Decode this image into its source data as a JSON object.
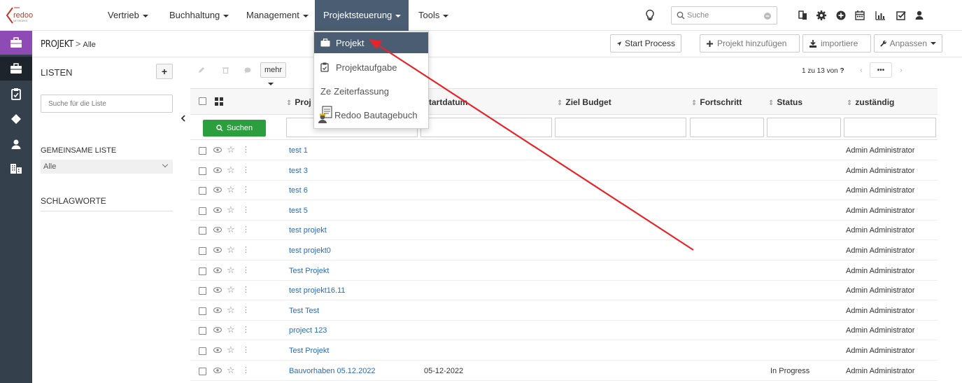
{
  "logo": {
    "text": "redoo",
    "subtext": "NETWORKS",
    "color": "#c0392b"
  },
  "nav": {
    "items": [
      {
        "label": "Vertrieb"
      },
      {
        "label": "Buchhaltung"
      },
      {
        "label": "Management"
      },
      {
        "label": "Projektsteuerung"
      },
      {
        "label": "Tools"
      }
    ],
    "search_placeholder": "Suche"
  },
  "breadcrumb": {
    "module": "PROJEKT",
    "separator": ">",
    "view": "Alle"
  },
  "actions": {
    "start_process": "Start Process",
    "add_project": "Projekt hinzufügen",
    "import": "importiere",
    "customize": "Anpassen"
  },
  "lists_panel": {
    "title": "LISTEN",
    "add": "+",
    "search_placeholder": "Suche für die Liste",
    "shared_title": "GEMEINSAME LISTE",
    "shared_selected": "Alle",
    "tags_title": "SCHLAGWORTE"
  },
  "toolbar": {
    "more": "mehr"
  },
  "paging": {
    "text": "1 zu 13 von",
    "unknown": "?",
    "more": "•••"
  },
  "table": {
    "columns": {
      "name": "Proj",
      "start": "Startdatum",
      "budget": "Ziel Budget",
      "progress": "Fortschritt",
      "status": "Status",
      "owner": "zuständig"
    },
    "search_button": "Suchen",
    "rows": [
      {
        "name": "test 1",
        "date": "",
        "status": "",
        "owner": "Admin Administrator"
      },
      {
        "name": "test 3",
        "date": "",
        "status": "",
        "owner": "Admin Administrator"
      },
      {
        "name": "test 6",
        "date": "",
        "status": "",
        "owner": "Admin Administrator"
      },
      {
        "name": "test 5",
        "date": "",
        "status": "",
        "owner": "Admin Administrator"
      },
      {
        "name": "test projekt",
        "date": "",
        "status": "",
        "owner": "Admin Administrator"
      },
      {
        "name": "test projekt0",
        "date": "",
        "status": "",
        "owner": "Admin Administrator"
      },
      {
        "name": "Test Projekt",
        "date": "",
        "status": "",
        "owner": "Admin Administrator"
      },
      {
        "name": "test projekt16.11",
        "date": "",
        "status": "",
        "owner": "Admin Administrator"
      },
      {
        "name": "Test Test",
        "date": "",
        "status": "",
        "owner": "Admin Administrator"
      },
      {
        "name": "project 123",
        "date": "",
        "status": "",
        "owner": "Admin Administrator"
      },
      {
        "name": "Test Projekt",
        "date": "",
        "status": "",
        "owner": "Admin Administrator"
      },
      {
        "name": "Bauvorhaben 05.12.2022",
        "date": "05-12-2022",
        "status": "In Progress",
        "owner": "Admin Administrator"
      }
    ]
  },
  "dropdown": {
    "items": [
      {
        "label": "Projekt",
        "icon": "briefcase-icon"
      },
      {
        "label": "Projektaufgabe",
        "icon": "clipboard-icon"
      },
      {
        "label": "Zeiterfassung",
        "icon": "ze-text-icon",
        "prefix": "Ze"
      },
      {
        "label": "Redoo Bautagebuch",
        "icon": "bautagebuch-icon"
      }
    ]
  },
  "colors": {
    "navActive": "#4a5d72",
    "iconbar": "#35404d",
    "iconbarFirst": "#8e4bb5",
    "link": "#2a6cb6",
    "searchBtn": "#2b9e3d",
    "arrow": "#e8232a"
  }
}
